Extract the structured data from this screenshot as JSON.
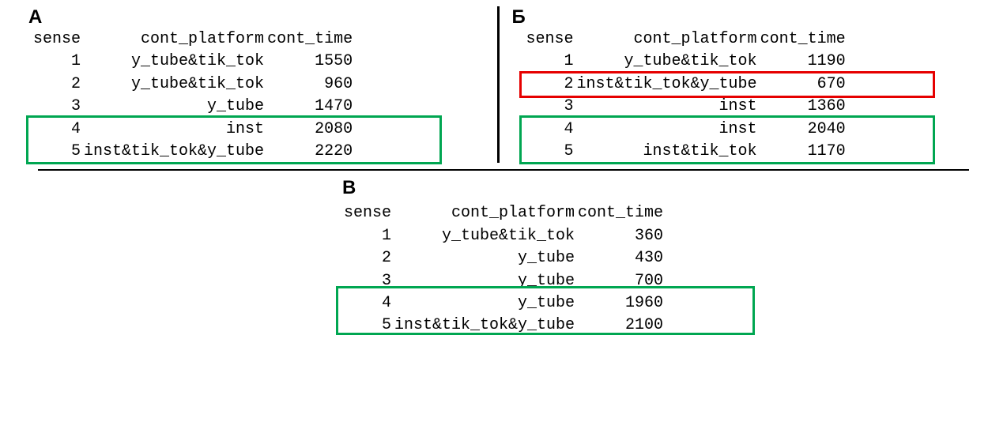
{
  "columns": {
    "sense": "sense",
    "platform": "cont_platform",
    "time": "cont_time"
  },
  "labels": {
    "A": "А",
    "B": "Б",
    "V": "В"
  },
  "panels": {
    "A": {
      "rows": [
        {
          "sense": "1",
          "platform": "y_tube&tik_tok",
          "time": "1550"
        },
        {
          "sense": "2",
          "platform": "y_tube&tik_tok",
          "time": "960"
        },
        {
          "sense": "3",
          "platform": "y_tube",
          "time": "1470"
        },
        {
          "sense": "4",
          "platform": "inst",
          "time": "2080"
        },
        {
          "sense": "5",
          "platform": "inst&tik_tok&y_tube",
          "time": "2220"
        }
      ]
    },
    "B": {
      "rows": [
        {
          "sense": "1",
          "platform": "y_tube&tik_tok",
          "time": "1190"
        },
        {
          "sense": "2",
          "platform": "inst&tik_tok&y_tube",
          "time": "670"
        },
        {
          "sense": "3",
          "platform": "inst",
          "time": "1360"
        },
        {
          "sense": "4",
          "platform": "inst",
          "time": "2040"
        },
        {
          "sense": "5",
          "platform": "inst&tik_tok",
          "time": "1170"
        }
      ]
    },
    "V": {
      "rows": [
        {
          "sense": "1",
          "platform": "y_tube&tik_tok",
          "time": "360"
        },
        {
          "sense": "2",
          "platform": "y_tube",
          "time": "430"
        },
        {
          "sense": "3",
          "platform": "y_tube",
          "time": "700"
        },
        {
          "sense": "4",
          "platform": "y_tube",
          "time": "1960"
        },
        {
          "sense": "5",
          "platform": "inst&tik_tok&y_tube",
          "time": "2100"
        }
      ]
    }
  },
  "highlights": {
    "A": [
      {
        "rows": [
          4,
          5
        ],
        "class": "green"
      }
    ],
    "B": [
      {
        "rows": [
          2
        ],
        "class": "red"
      },
      {
        "rows": [
          4,
          5
        ],
        "class": "green"
      }
    ],
    "V": [
      {
        "rows": [
          4,
          5
        ],
        "class": "green"
      }
    ]
  }
}
